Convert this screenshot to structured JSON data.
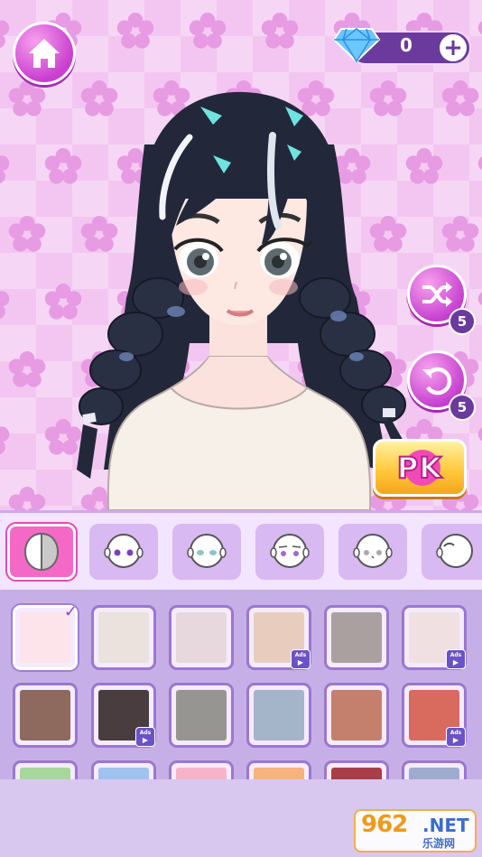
{
  "currency": {
    "gem_count": "0",
    "plus_label": "+",
    "icon": "diamond-icon"
  },
  "buttons": {
    "home_icon": "home-icon",
    "shuffle": {
      "icon": "shuffle-icon",
      "count": "5"
    },
    "reset": {
      "icon": "undo-icon",
      "count": "5"
    },
    "pk_label": "PK"
  },
  "tabs": [
    {
      "name": "skin-tone",
      "active": true
    },
    {
      "name": "face-shape-1"
    },
    {
      "name": "face-shape-2"
    },
    {
      "name": "face-shape-3"
    },
    {
      "name": "face-shape-4"
    },
    {
      "name": "face-shape-5"
    }
  ],
  "swatches": {
    "rows": [
      [
        {
          "color": "#fde3ea",
          "selected": true,
          "ads": false
        },
        {
          "color": "#ebe1dd",
          "ads": false
        },
        {
          "color": "#e7d8dd",
          "ads": false
        },
        {
          "color": "#e8cdbf",
          "ads": true
        },
        {
          "color": "#aaa0a0",
          "ads": false
        },
        {
          "color": "#f0e0e1",
          "ads": true
        }
      ],
      [
        {
          "color": "#8e6a5e",
          "ads": false
        },
        {
          "color": "#4a3d40",
          "ads": true
        },
        {
          "color": "#969591",
          "ads": false
        },
        {
          "color": "#a5b5c9",
          "ads": false
        },
        {
          "color": "#c47f6d",
          "ads": false
        },
        {
          "color": "#d96a5e",
          "ads": true
        }
      ],
      [
        {
          "color": "#a7d79b"
        },
        {
          "color": "#9fc2ef"
        },
        {
          "color": "#f7b4c8"
        },
        {
          "color": "#f7b27e"
        },
        {
          "color": "#a83e48"
        },
        {
          "color": "#9eabcf"
        }
      ]
    ],
    "ads_label": "Ads"
  },
  "watermark": {
    "number": "962",
    "net": ".NET",
    "chinese": "乐游网"
  },
  "colors": {
    "accent_pink": "#f469c6",
    "accent_purple": "#6b3a9d",
    "panel": "#c6afe6"
  }
}
